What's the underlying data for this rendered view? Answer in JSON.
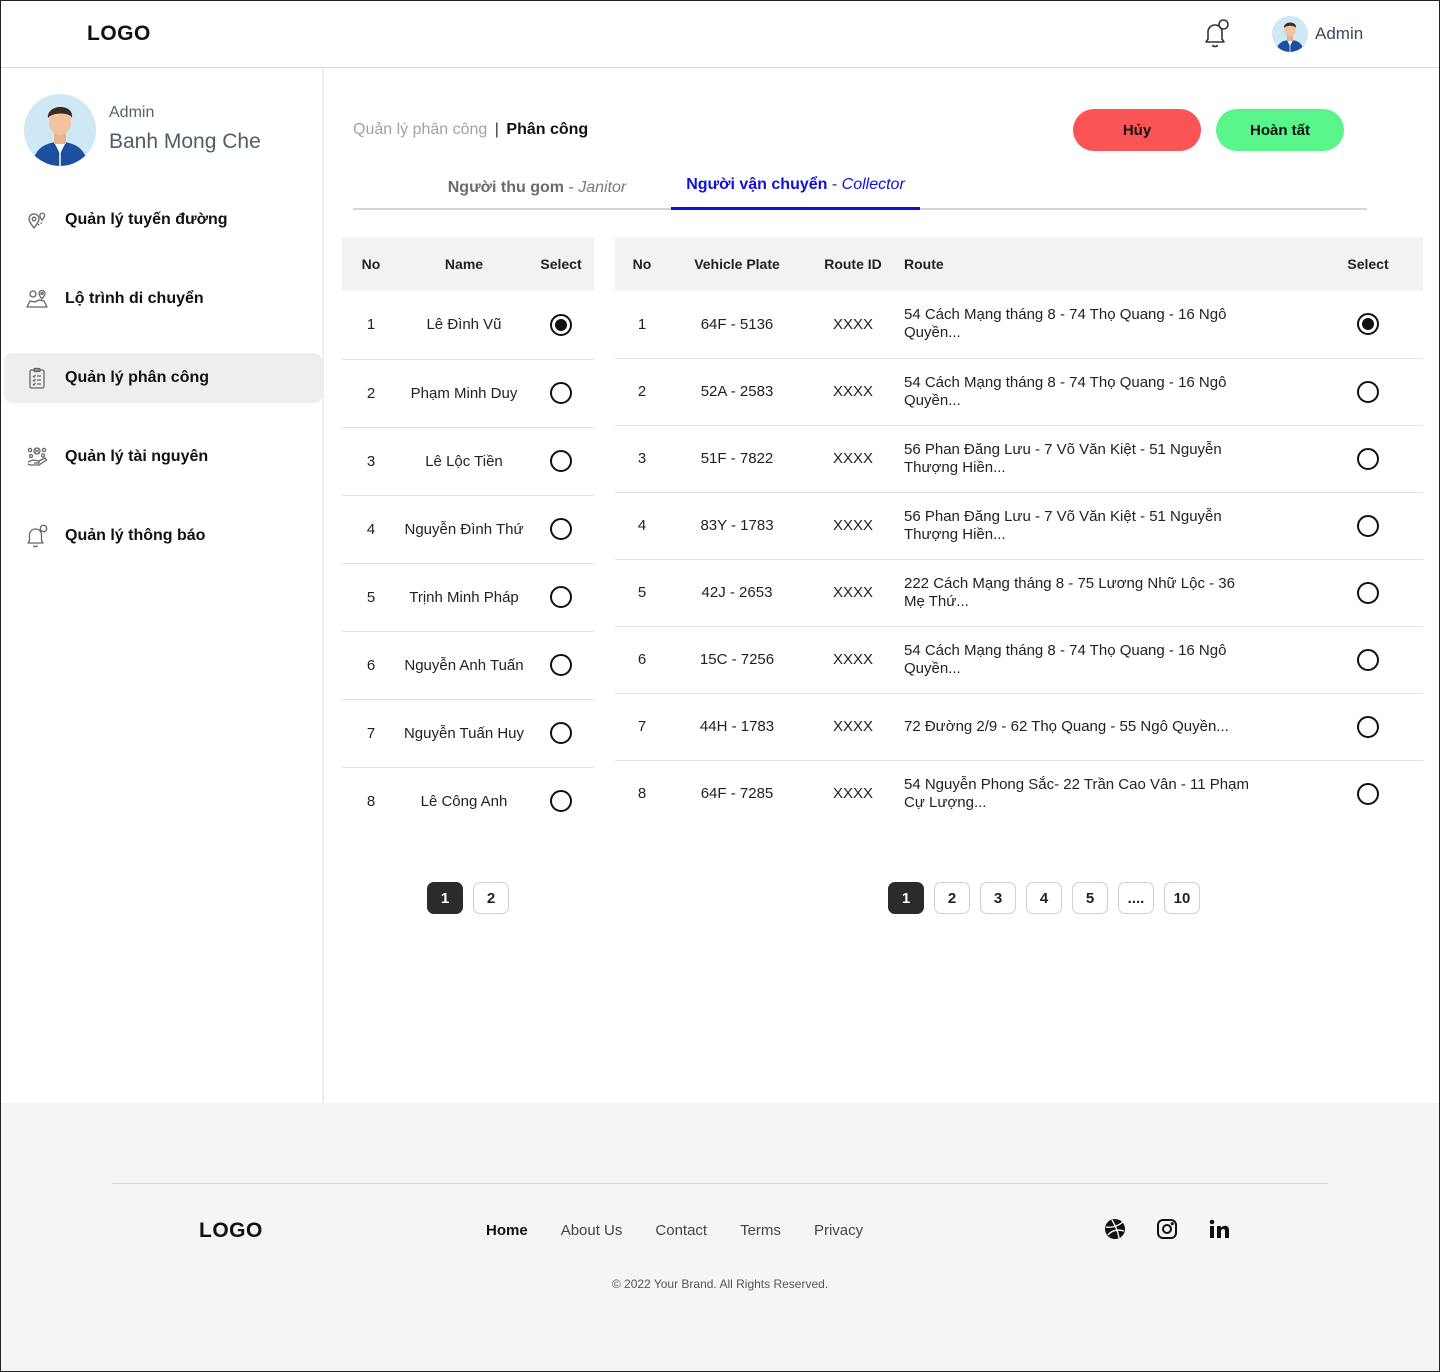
{
  "header": {
    "logo": "LOGO",
    "user_name": "Admin"
  },
  "sidebar": {
    "profile": {
      "role": "Admin",
      "name": "Banh Mong Che"
    },
    "items": [
      {
        "label": "Quản lý tuyến đường",
        "icon": "map-pin-icon",
        "active": false
      },
      {
        "label": "Lộ trình di chuyển",
        "icon": "route-map-icon",
        "active": false
      },
      {
        "label": "Quản lý phân công",
        "icon": "clipboard-icon",
        "active": true
      },
      {
        "label": "Quản lý tài nguyên",
        "icon": "resource-icon",
        "active": false
      },
      {
        "label": "Quản lý thông báo",
        "icon": "bell-icon",
        "active": false
      }
    ]
  },
  "breadcrumb": {
    "parent": "Quản lý phân công",
    "separator": "|",
    "current": "Phân công"
  },
  "actions": {
    "cancel_label": "Hủy",
    "done_label": "Hoàn tất"
  },
  "tabs": [
    {
      "main": "Người thu gom",
      "dash": " - ",
      "sub": "Janitor",
      "active": false
    },
    {
      "main": "Người vận chuyển",
      "dash": " - ",
      "sub": "Collector",
      "active": true
    }
  ],
  "left_table": {
    "headers": [
      "No",
      "Name",
      "Select"
    ],
    "rows": [
      {
        "no": "1",
        "name": "Lê Đình Vũ",
        "selected": true
      },
      {
        "no": "2",
        "name": "Phạm Minh Duy",
        "selected": false
      },
      {
        "no": "3",
        "name": "Lê Lộc Tiền",
        "selected": false
      },
      {
        "no": "4",
        "name": "Nguyễn Đình Thứ",
        "selected": false
      },
      {
        "no": "5",
        "name": "Trịnh Minh Pháp",
        "selected": false
      },
      {
        "no": "6",
        "name": "Nguyễn Anh Tuấn",
        "selected": false
      },
      {
        "no": "7",
        "name": "Nguyễn Tuấn Huy",
        "selected": false
      },
      {
        "no": "8",
        "name": "Lê Công Anh",
        "selected": false
      }
    ],
    "pages": [
      "1",
      "2"
    ],
    "active_page": "1"
  },
  "right_table": {
    "headers": [
      "No",
      "Vehicle Plate",
      "Route ID",
      "Route",
      "Select"
    ],
    "rows": [
      {
        "no": "1",
        "plate": "64F - 5136",
        "route_id": "XXXX",
        "route": "54 Cách Mạng tháng 8 - 74 Thọ Quang - 16 Ngô Quyền...",
        "selected": true
      },
      {
        "no": "2",
        "plate": "52A - 2583",
        "route_id": "XXXX",
        "route": "54 Cách Mạng tháng 8 - 74 Thọ Quang - 16 Ngô Quyền...",
        "selected": false
      },
      {
        "no": "3",
        "plate": "51F - 7822",
        "route_id": "XXXX",
        "route": "56 Phan Đăng Lưu - 7 Võ Văn Kiệt - 51 Nguyễn Thượng Hiền...",
        "selected": false
      },
      {
        "no": "4",
        "plate": "83Y - 1783",
        "route_id": "XXXX",
        "route": "56 Phan Đăng Lưu - 7 Võ Văn Kiệt - 51 Nguyễn Thượng Hiền...",
        "selected": false
      },
      {
        "no": "5",
        "plate": "42J - 2653",
        "route_id": "XXXX",
        "route": "222 Cách Mạng tháng 8 - 75 Lương Nhữ Lộc - 36 Mẹ Thứ...",
        "selected": false
      },
      {
        "no": "6",
        "plate": "15C - 7256",
        "route_id": "XXXX",
        "route": "54 Cách Mạng tháng 8 - 74 Thọ Quang - 16 Ngô Quyền...",
        "selected": false
      },
      {
        "no": "7",
        "plate": "44H - 1783",
        "route_id": "XXXX",
        "route": "72 Đường 2/9 - 62 Thọ Quang - 55 Ngô Quyền...",
        "selected": false
      },
      {
        "no": "8",
        "plate": "64F - 7285",
        "route_id": "XXXX",
        "route": "54 Nguyễn Phong Sắc- 22 Trần Cao Vân - 11 Phạm Cự Lượng...",
        "selected": false
      }
    ],
    "pages": [
      "1",
      "2",
      "3",
      "4",
      "5",
      "....",
      "10"
    ],
    "active_page": "1"
  },
  "footer": {
    "logo": "LOGO",
    "links": [
      "Home",
      "About Us",
      "Contact",
      "Terms",
      "Privacy"
    ],
    "social": [
      "dribbble-icon",
      "instagram-icon",
      "linkedin-icon"
    ],
    "copyright": "© 2022 Your Brand. All Rights Reserved."
  }
}
